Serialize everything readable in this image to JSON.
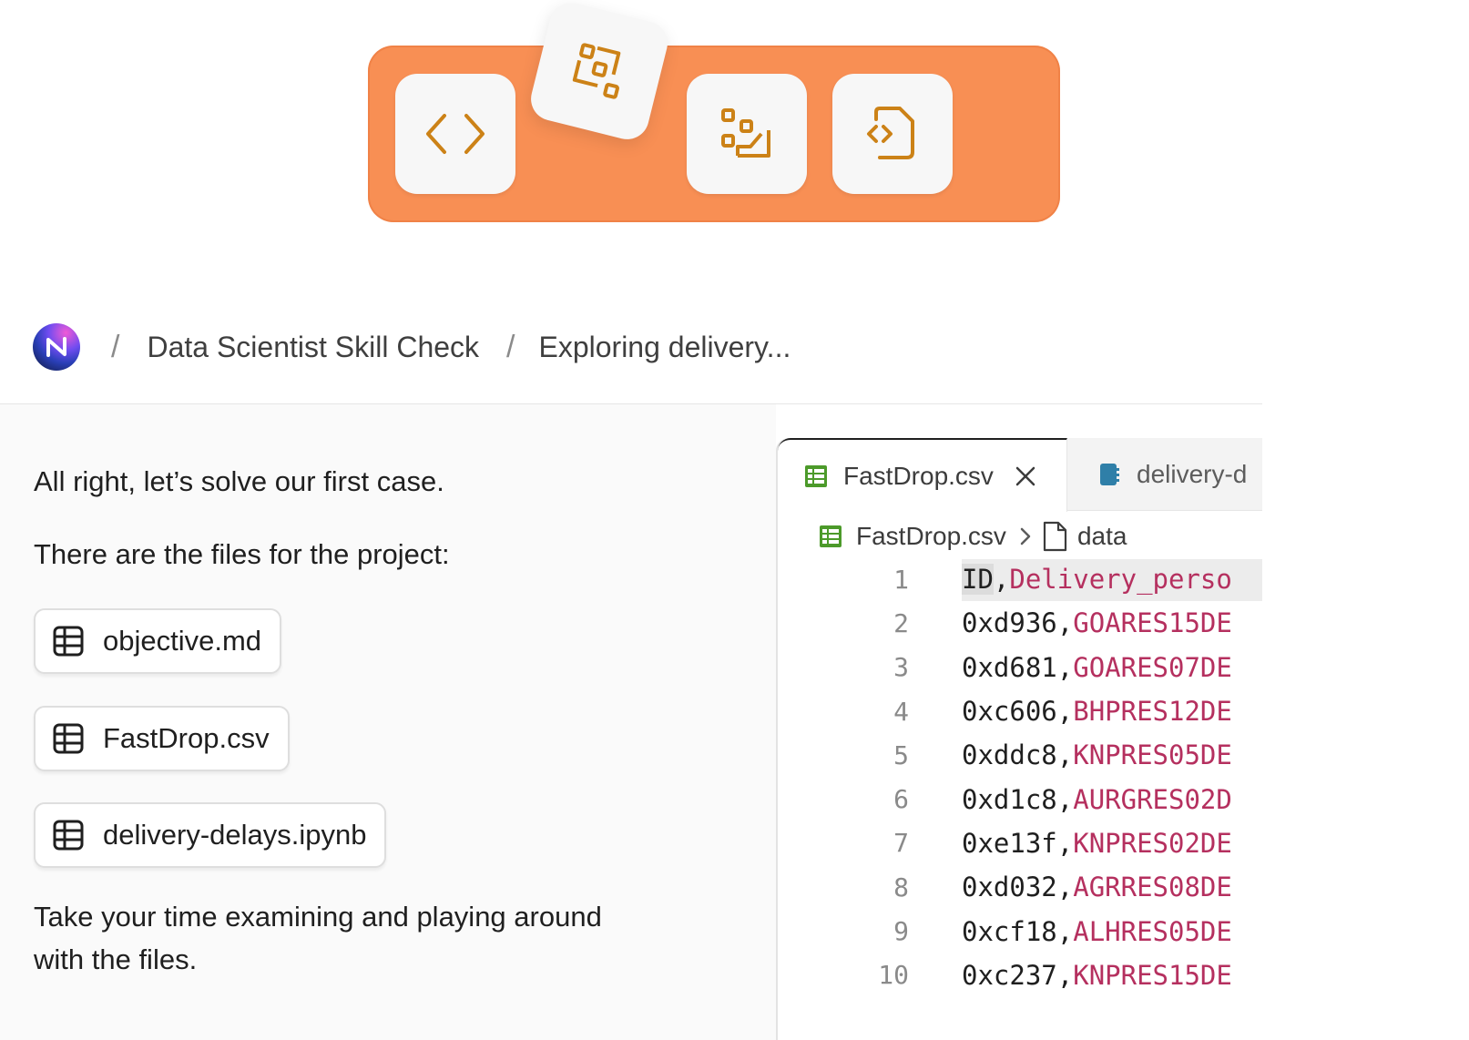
{
  "toolbar": {
    "buttons": [
      {
        "name": "code",
        "icon": "code-brackets-icon"
      },
      {
        "name": "floating",
        "icon": "shapes-cluster-icon"
      },
      {
        "name": "shapes",
        "icon": "shapes-path-icon"
      },
      {
        "name": "file-code",
        "icon": "file-code-icon"
      }
    ],
    "accent": "#f88f54",
    "icon_color": "#cc8217"
  },
  "breadcrumb": {
    "logo_icon": "n-logo-icon",
    "separator": "/",
    "items": [
      "Data Scientist Skill Check",
      "Exploring delivery..."
    ]
  },
  "chat": {
    "intro": "All right, let’s solve our first case.",
    "files_intro": "There are the files for the project:",
    "files": [
      {
        "label": "objective.md",
        "icon": "table-icon"
      },
      {
        "label": "FastDrop.csv",
        "icon": "table-icon"
      },
      {
        "label": "delivery-delays.ipynb",
        "icon": "table-icon"
      }
    ],
    "outro_line1": "Take your time examining and playing around",
    "outro_line2": "with the files."
  },
  "editor": {
    "tabs": [
      {
        "label": "FastDrop.csv",
        "icon": "spreadsheet-icon",
        "active": true
      },
      {
        "label": "delivery-d",
        "icon": "notebook-icon",
        "active": false
      }
    ],
    "path": {
      "file": "FastDrop.csv",
      "folder": "data"
    },
    "lines": [
      {
        "n": "1",
        "id": "ID",
        "val": "Delivery_perso"
      },
      {
        "n": "2",
        "id": "0xd936",
        "val": "GOARES15DE"
      },
      {
        "n": "3",
        "id": "0xd681",
        "val": "GOARES07DE"
      },
      {
        "n": "4",
        "id": "0xc606",
        "val": "BHPRES12DE"
      },
      {
        "n": "5",
        "id": "0xddc8",
        "val": "KNPRES05DE"
      },
      {
        "n": "6",
        "id": "0xd1c8",
        "val": "AURGRES02D"
      },
      {
        "n": "7",
        "id": "0xe13f",
        "val": "KNPRES02DE"
      },
      {
        "n": "8",
        "id": "0xd032",
        "val": "AGRRES08DE"
      },
      {
        "n": "9",
        "id": "0xcf18",
        "val": "ALHRES05DE"
      },
      {
        "n": "10",
        "id": "0xc237",
        "val": "KNPRES15DE"
      }
    ]
  }
}
